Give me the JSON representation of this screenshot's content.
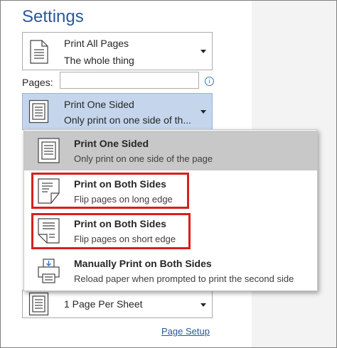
{
  "settings": {
    "title": "Settings"
  },
  "print_range": {
    "line1": "Print All Pages",
    "line2": "The whole thing"
  },
  "pages": {
    "label": "Pages:",
    "value": ""
  },
  "sides_dropdown": {
    "line1": "Print One Sided",
    "line2": "Only print on one side of th..."
  },
  "menu": {
    "items": [
      {
        "title": "Print One Sided",
        "subtitle": "Only print on one side of the page",
        "icon": "one-sided-page-icon",
        "selected": true
      },
      {
        "title": "Print on Both Sides",
        "subtitle": "Flip pages on long edge",
        "icon": "duplex-long-edge-icon",
        "highlighted": true
      },
      {
        "title": "Print on Both Sides",
        "subtitle": "Flip pages on short edge",
        "icon": "duplex-short-edge-icon",
        "highlighted": true
      },
      {
        "title": "Manually Print on Both Sides",
        "subtitle": "Reload paper when prompted to print the second side",
        "icon": "manual-duplex-printer-icon"
      }
    ]
  },
  "pages_per_sheet": {
    "line1": "1 Page Per Sheet"
  },
  "footer": {
    "page_setup": "Page Setup"
  },
  "colors": {
    "accent": "#2b579a",
    "selected_bg": "#c5d6ec",
    "highlight_border": "#d81e1e",
    "menu_selected_bg": "#c8c8c8"
  }
}
